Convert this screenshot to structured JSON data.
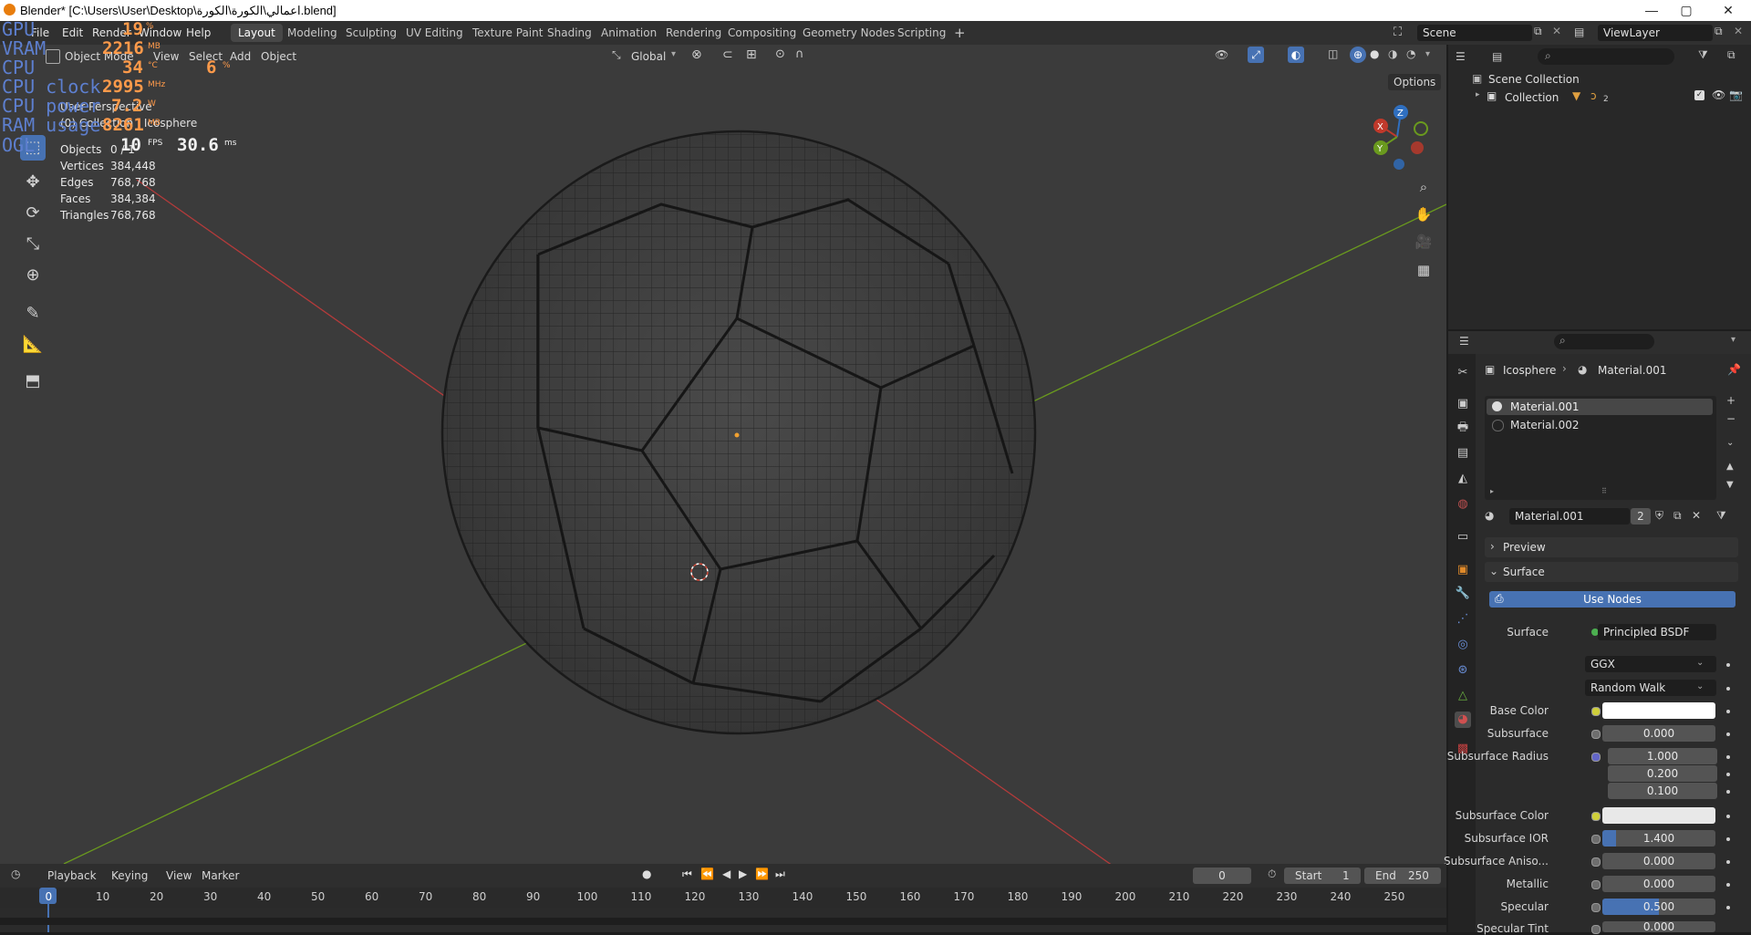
{
  "window": {
    "title": "Blender* [C:\\Users\\User\\Desktop\\اعمالي\\الكورة\\الكورة.blend]",
    "minimize": "—",
    "maximize": "▢",
    "close": "✕"
  },
  "menubar": {
    "file": "File",
    "edit": "Edit",
    "render": "Render",
    "window": "Window",
    "help": "Help",
    "tabs": [
      "Layout",
      "Modeling",
      "Sculpting",
      "UV Editing",
      "Texture Paint",
      "Shading",
      "Animation",
      "Rendering",
      "Compositing",
      "Geometry Nodes",
      "Scripting"
    ],
    "active_tab": "Layout",
    "add_tab": "+",
    "scene": "Scene",
    "view_layer": "ViewLayer"
  },
  "viewport_header": {
    "mode": "Object Mode",
    "view": "View",
    "select": "Select",
    "add": "Add",
    "object": "Object",
    "orientation": "Global",
    "options": "Options"
  },
  "viewport_info": {
    "view_name": "User Perspective",
    "collection": "(0) Collection | Icosphere"
  },
  "stats": {
    "objects_label": "Objects",
    "objects_value": "0 / 1",
    "vertices_label": "Vertices",
    "vertices_value": "384,448",
    "edges_label": "Edges",
    "edges_value": "768,768",
    "faces_label": "Faces",
    "faces_value": "384,384",
    "triangles_label": "Triangles",
    "triangles_value": "768,768"
  },
  "overlay_monitor": {
    "gpu_label": "GPU",
    "gpu_value": "19",
    "gpu_unit": "%",
    "vram_label": "VRAM",
    "vram_value": "2216",
    "vram_unit": "MB",
    "cpu_label": "CPU",
    "cpu_value": "34",
    "cpu_unit": "°C",
    "cpu_pct_value": "6",
    "cpu_pct_unit": "%",
    "cpu_clock_label": "CPU clock",
    "cpu_clock_value": "2995",
    "cpu_clock_unit": "MHz",
    "cpu_power_label": "CPU power",
    "cpu_power_value": "7.2",
    "cpu_power_unit": "W",
    "ram_label": "RAM usage",
    "ram_value": "8261",
    "ram_unit": "MB",
    "ogl_label": "OGL",
    "fps_value": "10",
    "fps_unit": "FPS",
    "ms_value": "30.6",
    "ms_unit": "ms"
  },
  "outliner": {
    "scene_collection": "Scene Collection",
    "collection": "Collection",
    "collection_count": "2"
  },
  "properties": {
    "breadcrumb_object": "Icosphere",
    "breadcrumb_material": "Material.001",
    "slots": [
      "Material.001",
      "Material.002"
    ],
    "material_name": "Material.001",
    "users": "2",
    "preview": "Preview",
    "surface_panel": "Surface",
    "use_nodes": "Use Nodes",
    "surface_label": "Surface",
    "surface_value": "Principled BSDF",
    "distribution": "GGX",
    "subsurface_method": "Random Walk",
    "base_color_label": "Base Color",
    "subsurface_label": "Subsurface",
    "subsurface_value": "0.000",
    "subsurface_radius_label": "Subsurface Radius",
    "subsurface_radius": [
      "1.000",
      "0.200",
      "0.100"
    ],
    "subsurface_color_label": "Subsurface Color",
    "subsurface_ior_label": "Subsurface IOR",
    "subsurface_ior_value": "1.400",
    "subsurface_aniso_label": "Subsurface Aniso...",
    "subsurface_aniso_value": "0.000",
    "metallic_label": "Metallic",
    "metallic_value": "0.000",
    "specular_label": "Specular",
    "specular_value": "0.500",
    "specular_tint_label": "Specular Tint",
    "specular_tint_value": "0.000"
  },
  "timeline": {
    "playback": "Playback",
    "keying": "Keying",
    "view": "View",
    "marker": "Marker",
    "current_frame": "0",
    "start_label": "Start",
    "start_value": "1",
    "end_label": "End",
    "end_value": "250",
    "ruler": [
      "0",
      "10",
      "20",
      "30",
      "40",
      "50",
      "60",
      "70",
      "80",
      "90",
      "100",
      "110",
      "120",
      "130",
      "140",
      "150",
      "160",
      "170",
      "180",
      "190",
      "200",
      "210",
      "220",
      "230",
      "240",
      "250"
    ]
  },
  "colors": {
    "accent": "#4772b3",
    "x_axis": "#c0392b",
    "y_axis": "#6a9a1e",
    "z_axis": "#2f6fc0",
    "base_color": "#ffffff",
    "subsurface_color": "#e8e8e8",
    "overlay_label": "#5d7fcf",
    "overlay_value": "#ff9a4a"
  }
}
